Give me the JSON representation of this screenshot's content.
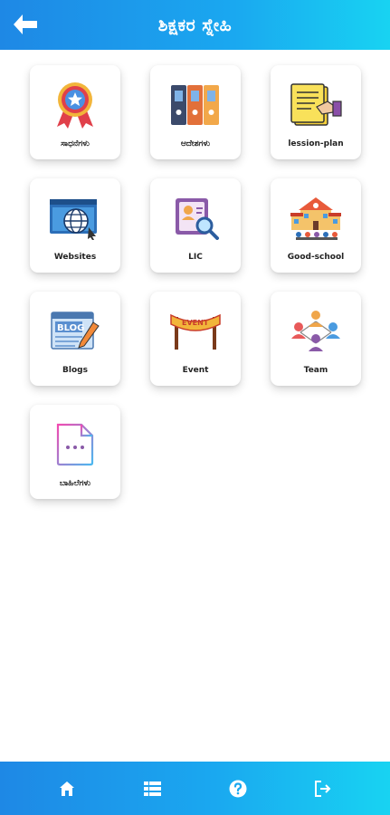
{
  "header": {
    "title": "ಶಿಕ್ಷಕರ ಸ್ನೇಹಿ"
  },
  "menu": {
    "items": [
      {
        "label": "ಸಾಧನೆಗಳು",
        "icon": "award-badge-icon"
      },
      {
        "label": "ಆದೇಶಗಳು",
        "icon": "binders-icon"
      },
      {
        "label": "lession-plan",
        "icon": "lesson-plan-document-icon"
      },
      {
        "label": "Websites",
        "icon": "globe-browser-icon"
      },
      {
        "label": "LIC",
        "icon": "id-search-icon"
      },
      {
        "label": "Good-school",
        "icon": "school-building-icon"
      },
      {
        "label": "Blogs",
        "icon": "blog-icon"
      },
      {
        "label": "Event",
        "icon": "event-banner-icon"
      },
      {
        "label": "Team",
        "icon": "team-people-icon"
      },
      {
        "label": "ಬಾಹಿಲೆಗಳು",
        "icon": "chat-document-icon"
      }
    ]
  },
  "bottom_nav": {
    "items": [
      {
        "icon": "home-icon"
      },
      {
        "icon": "list-icon"
      },
      {
        "icon": "help-icon"
      },
      {
        "icon": "logout-icon"
      }
    ]
  },
  "colors": {
    "header_gradient_start": "#1e88e5",
    "header_gradient_end": "#18d3f2",
    "card_background": "#ffffff"
  }
}
